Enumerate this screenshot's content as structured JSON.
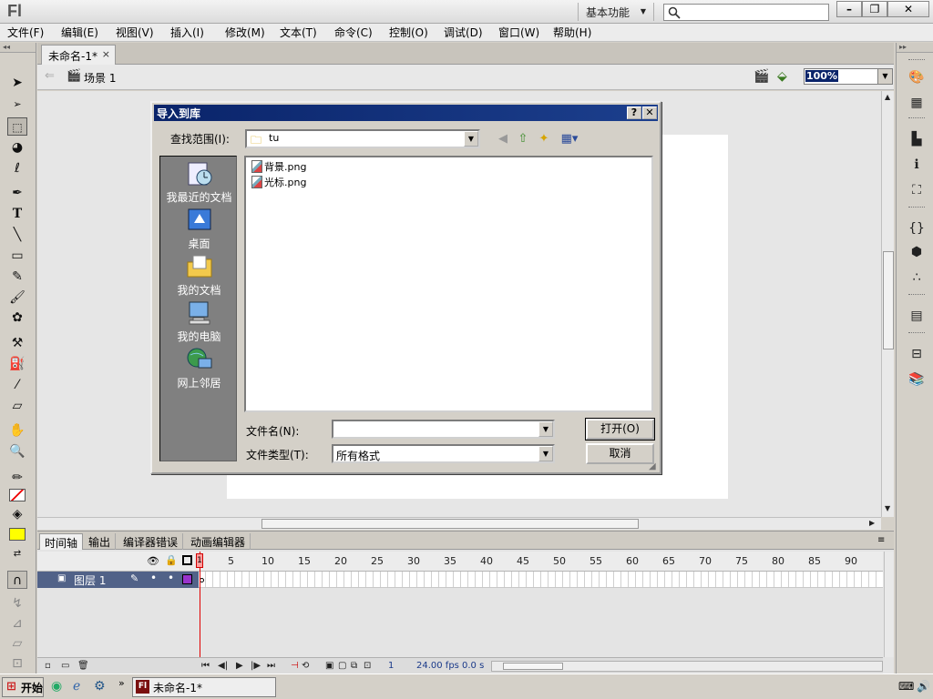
{
  "app": {
    "logo": "Fl",
    "workspace": "基本功能",
    "search_placeholder": ""
  },
  "window_controls": {
    "minimize": "–",
    "restore": "❐",
    "close": "✕"
  },
  "menu": [
    "文件(F)",
    "编辑(E)",
    "视图(V)",
    "插入(I)",
    "修改(M)",
    "文本(T)",
    "命令(C)",
    "控制(O)",
    "调试(D)",
    "窗口(W)",
    "帮助(H)"
  ],
  "document": {
    "tab_title": "未命名-1*",
    "tab_close": "×",
    "scene": "场景 1",
    "zoom": "100%"
  },
  "dialog": {
    "title": "导入到库",
    "help": "?",
    "close": "✕",
    "look_in_label": "查找范围(I):",
    "look_in_value": "tu",
    "places": [
      "我最近的文档",
      "桌面",
      "我的文档",
      "我的电脑",
      "网上邻居"
    ],
    "files": [
      "背景.png",
      "光标.png"
    ],
    "filename_label": "文件名(N):",
    "filename_value": "",
    "filetype_label": "文件类型(T):",
    "filetype_value": "所有格式",
    "open_button": "打开(O)",
    "cancel_button": "取消"
  },
  "timeline": {
    "tabs": [
      "时间轴",
      "输出",
      "编译器错误",
      "动画编辑器"
    ],
    "frame_numbers": [
      "1",
      "5",
      "10",
      "15",
      "20",
      "25",
      "30",
      "35",
      "40",
      "45",
      "50",
      "55",
      "60",
      "65",
      "70",
      "75",
      "80",
      "85",
      "90"
    ],
    "layer_name": "图层 1",
    "current_frame": "1",
    "fps": "24.00 fps",
    "time": "0.0 s"
  },
  "taskbar": {
    "start": "开始",
    "task": "未命名-1*"
  },
  "colors": {
    "dialog_title": "#0a246a",
    "layer_selected": "#516288",
    "playhead": "#e00000",
    "fill_color": "#ffff00",
    "layer_outline": "#9933cc"
  }
}
